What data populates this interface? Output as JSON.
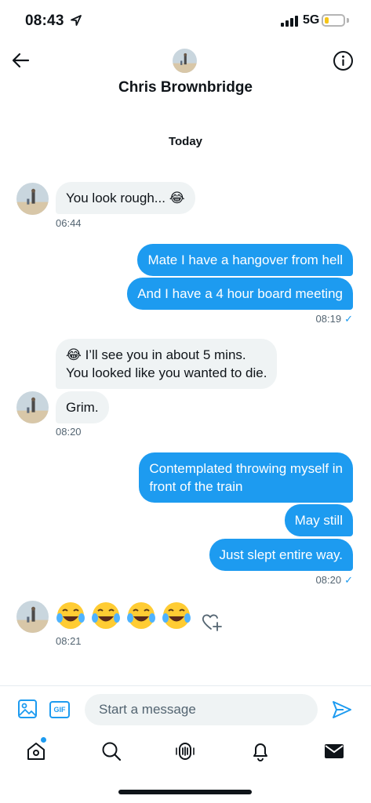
{
  "status": {
    "time": "08:43",
    "network": "5G"
  },
  "header": {
    "contact_name": "Chris Brownbridge"
  },
  "conversation": {
    "date_label": "Today",
    "messages": [
      {
        "from": "them",
        "text": "You look rough... 😂",
        "time": "06:44"
      },
      {
        "from": "me",
        "text": "Mate I have a hangover from hell"
      },
      {
        "from": "me",
        "text": "And I have a 4 hour board meeting",
        "time": "08:19"
      },
      {
        "from": "them",
        "lines": [
          "😂 I’ll see you in about 5 mins.",
          "You looked like you wanted to die."
        ]
      },
      {
        "from": "them",
        "text": "Grim.",
        "time": "08:20"
      },
      {
        "from": "me",
        "lines": [
          "Contemplated throwing myself in",
          "front of the train"
        ]
      },
      {
        "from": "me",
        "text": "May still"
      },
      {
        "from": "me",
        "text": "Just slept entire way.",
        "time": "08:20"
      },
      {
        "from": "them",
        "emoji": [
          "😂",
          "😂",
          "😂",
          "😂"
        ],
        "time": "08:21"
      }
    ],
    "read_mark": "✓"
  },
  "composer": {
    "placeholder": "Start a message",
    "gif_label": "GIF"
  },
  "nav": {
    "items": [
      "home-icon",
      "search-icon",
      "spaces-icon",
      "notifications-icon",
      "messages-icon"
    ],
    "active": "messages-icon"
  },
  "colors": {
    "accent": "#1d9bf0",
    "incoming_bubble": "#eff3f4",
    "text": "#0f1419",
    "muted": "#536471"
  }
}
